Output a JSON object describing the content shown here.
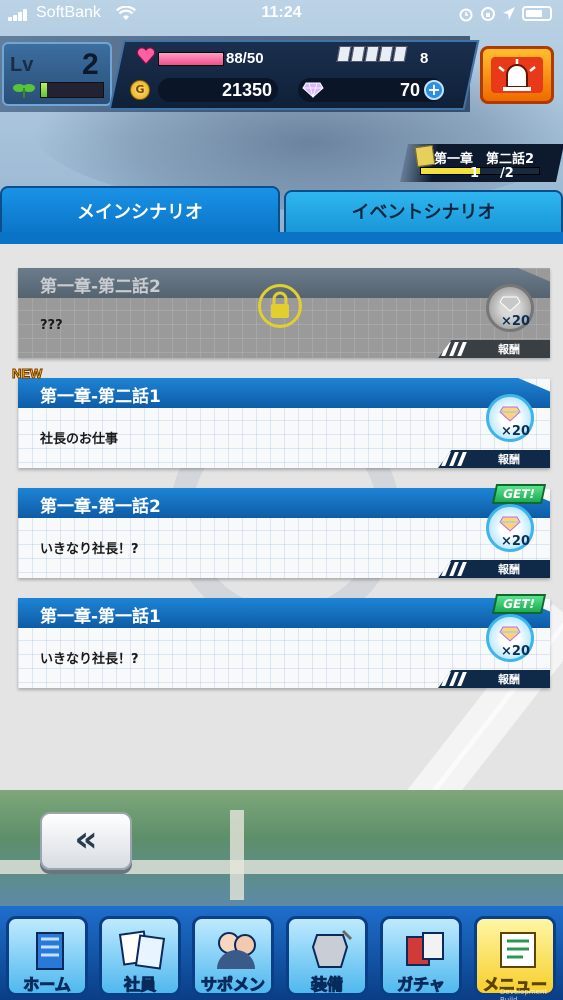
{
  "status_bar": {
    "carrier": "SoftBank",
    "time": "11:24"
  },
  "hud": {
    "level_label": "Lv",
    "level": "2",
    "level_progress": 0.1,
    "stamina": "88/50",
    "stamina_progress": 1.0,
    "tickets": "8",
    "gold_symbol": "G",
    "gold": "21350",
    "gems": "70",
    "gems_add": "+"
  },
  "chapter": {
    "title": "第一章　第二話2",
    "current": "1",
    "total": "/2",
    "progress": 0.5
  },
  "tabs": [
    {
      "label": "メインシナリオ",
      "active": true
    },
    {
      "label": "イベントシナリオ",
      "active": false
    }
  ],
  "stories": [
    {
      "title": "第一章-第二話2",
      "subtitle": "???",
      "reward_qty": "×20",
      "reward_label": "報酬",
      "locked": true,
      "badge": ""
    },
    {
      "title": "第一章-第二話1",
      "subtitle": "社長のお仕事",
      "reward_qty": "×20",
      "reward_label": "報酬",
      "locked": false,
      "badge": "NEW"
    },
    {
      "title": "第一章-第一話2",
      "subtitle": "いきなり社長！?",
      "reward_qty": "×20",
      "reward_label": "報酬",
      "locked": false,
      "badge": "GET!"
    },
    {
      "title": "第一章-第一話1",
      "subtitle": "いきなり社長！?",
      "reward_qty": "×20",
      "reward_label": "報酬",
      "locked": false,
      "badge": "GET!"
    }
  ],
  "back_button": "«",
  "nav": [
    {
      "label": "ホーム",
      "icon": "building-icon"
    },
    {
      "label": "社員",
      "icon": "staff-cards-icon"
    },
    {
      "label": "サポメン",
      "icon": "support-members-icon"
    },
    {
      "label": "装備",
      "icon": "armor-icon"
    },
    {
      "label": "ガチャ",
      "icon": "gacha-icon"
    },
    {
      "label": "メニュー",
      "icon": "menu-notebook-icon"
    }
  ],
  "watermark": "Development Build",
  "colors": {
    "tab_active": "#0b73c6",
    "tab_inactive": "#1a97d8",
    "card_header": "#0e5ca6",
    "get_badge": "#1eaa52",
    "new_badge": "#ffd21e"
  }
}
